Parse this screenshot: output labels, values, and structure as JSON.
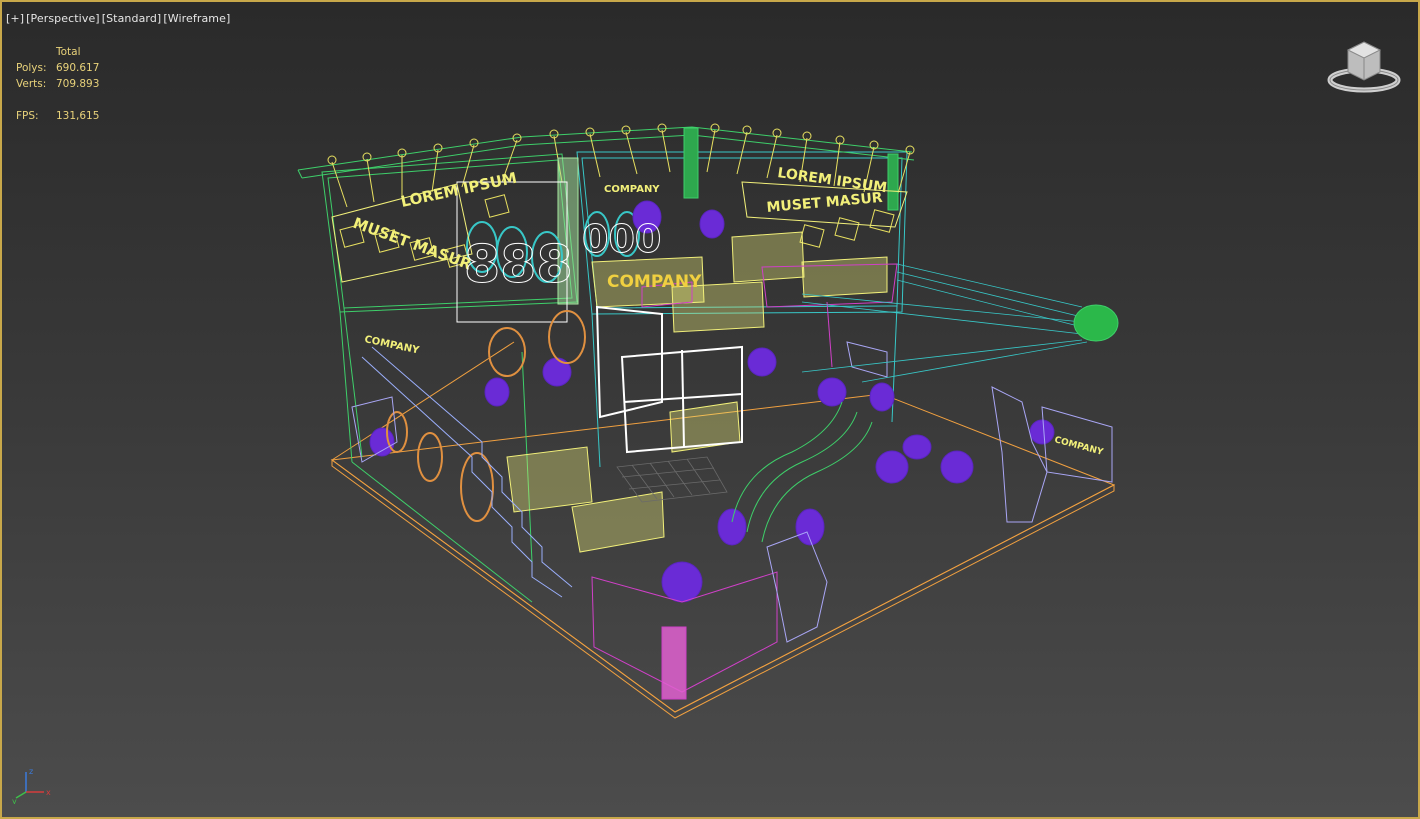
{
  "viewport": {
    "labels": [
      "[+]",
      "[Perspective]",
      "[Standard]",
      "[Wireframe]"
    ]
  },
  "stats": {
    "header": "Total",
    "polys_label": "Polys:",
    "polys_value": "690.617",
    "verts_label": "Verts:",
    "verts_value": "709.893",
    "fps_label": "FPS:",
    "fps_value": "131,615"
  },
  "scene_text": {
    "sign_left_top": "LOREM IPSUM",
    "sign_left_bottom": "MUSET MASUR",
    "sign_right_top": "LOREM IPSUM",
    "sign_right_bottom": "MUSET MASUR",
    "company_1": "COMPANY",
    "company_2": "COMPANY",
    "company_3": "COMPANY",
    "company_4": "COMPANY",
    "display_digits": "888",
    "display_digits_2": "000"
  },
  "colors": {
    "frame_border": "#c8a84a",
    "stats_text": "#e8d27a",
    "wire_green": "#3ecf6a",
    "wire_cyan": "#38c7c7",
    "wire_yellow": "#f2f07a",
    "wire_purple": "#6a2bd6",
    "wire_magenta": "#d040c8",
    "wire_orange": "#f0a040",
    "wire_lavender": "#a9a6f5",
    "wire_white": "#ffffff"
  },
  "icons": {
    "viewcube": "viewcube-icon",
    "axis": "axis-tripod-icon"
  }
}
